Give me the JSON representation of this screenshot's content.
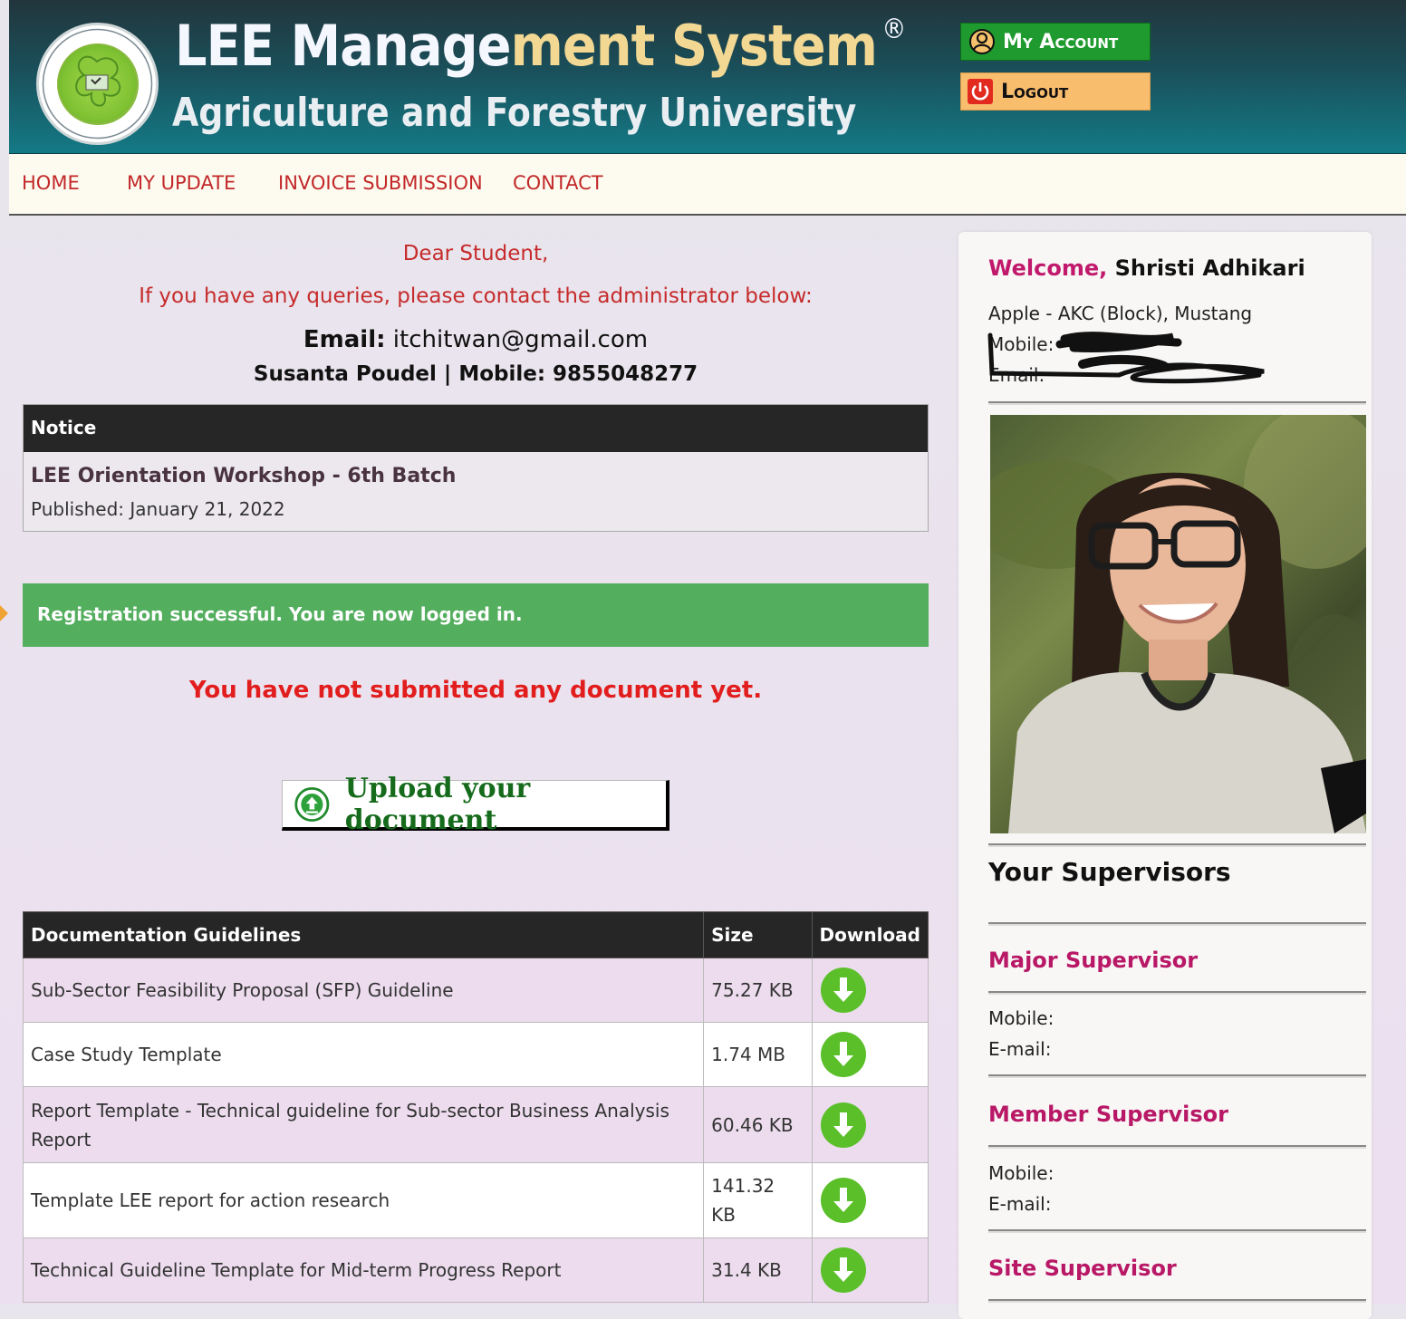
{
  "header": {
    "title_part1": "LEE Manage",
    "title_part2": "ment",
    "title_part3": " System",
    "registered": "®",
    "subtitle": "Agriculture and Forestry University",
    "my_account": "My Account",
    "logout": "Logout",
    "colors": {
      "account": "#1f9a2e",
      "logout": "#f9bd6e"
    }
  },
  "nav": {
    "items": [
      {
        "label": "HOME"
      },
      {
        "label": "MY UPDATE"
      },
      {
        "label": "INVOICE SUBMISSION"
      },
      {
        "label": "CONTACT"
      }
    ]
  },
  "contact": {
    "greeting": "Dear Student,",
    "queries": "If you have any queries, please contact the administrator below:",
    "email_label": "Email:",
    "email": "itchitwan@gmail.com",
    "admin": "Susanta Poudel | Mobile: 9855048277"
  },
  "notice": {
    "heading": "Notice",
    "title": "LEE Orientation Workshop - 6th Batch",
    "published": "Published: January 21, 2022"
  },
  "alert": {
    "message": "Registration successful. You are now logged in.",
    "color": "#53ae5e"
  },
  "no_document": "You have not submitted any document yet.",
  "upload_label": "Upload your document",
  "guidelines": {
    "headers": [
      "Documentation Guidelines",
      "Size",
      "Download"
    ],
    "rows": [
      {
        "name": "Sub-Sector Feasibility Proposal (SFP) Guideline",
        "size": "75.27 KB"
      },
      {
        "name": "Case Study Template",
        "size": "1.74 MB"
      },
      {
        "name": "Report Template - Technical guideline for Sub-sector Business Analysis Report",
        "size": "60.46 KB"
      },
      {
        "name": "Template LEE report for action research",
        "size": "141.32 KB"
      },
      {
        "name": "Technical Guideline Template for Mid-term Progress Report",
        "size": "31.4 KB"
      }
    ]
  },
  "sidebar": {
    "welcome_label": "Welcome,",
    "student_name": "Shristi Adhikari",
    "placement": "Apple - AKC (Block), Mustang",
    "mobile_label": "Mobile:",
    "email_label": "Email:",
    "supervisors_title": "Your Supervisors",
    "major": {
      "title": "Major Supervisor",
      "mobile": "Mobile:",
      "email": "E-mail:"
    },
    "member": {
      "title": "Member Supervisor",
      "mobile": "Mobile:",
      "email": "E-mail:"
    },
    "site": {
      "title": "Site Supervisor"
    }
  }
}
